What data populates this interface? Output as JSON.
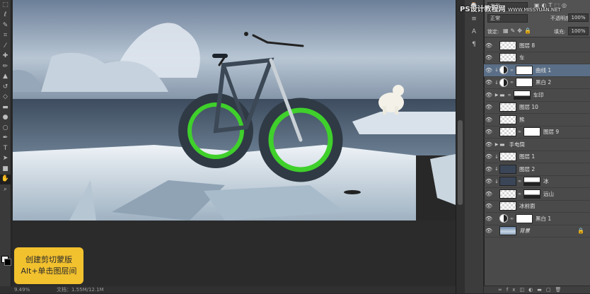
{
  "tools": [
    "marquee",
    "lasso",
    "quick-select",
    "crop",
    "eyedropper",
    "healing",
    "brush",
    "clone",
    "history",
    "eraser",
    "gradient",
    "blur",
    "dodge",
    "pen",
    "type",
    "path-select",
    "shape",
    "hand",
    "zoom"
  ],
  "status": {
    "zoom": "9.49%",
    "doc": "文档：1.55M/12.1M"
  },
  "callout": {
    "line1": "创建剪切蒙版",
    "line2": "Alt+单击图层间"
  },
  "watermark": {
    "line1": "PS设计教程网",
    "line2": "WWW.MISSYUAN.NET"
  },
  "layers_panel": {
    "kind": "类型",
    "blend_mode": "正常",
    "opacity_label": "不透明度:",
    "opacity_value": "100%",
    "lock_label": "锁定:",
    "fill_label": "填充:",
    "fill_value": "100%"
  },
  "layers": [
    {
      "name": "图层 8",
      "type": "pixel",
      "thumb": "checker",
      "selected": false
    },
    {
      "name": "车",
      "type": "pixel",
      "thumb": "checker",
      "selected": false
    },
    {
      "name": "曲线 1",
      "type": "adjustment",
      "thumb": "white",
      "selected": true,
      "clipped": true
    },
    {
      "name": "黑白 2",
      "type": "adjustment",
      "thumb": "white",
      "selected": false,
      "clipped": true
    },
    {
      "name": "车印",
      "type": "group",
      "thumb": "mask",
      "selected": false
    },
    {
      "name": "图层 10",
      "type": "pixel",
      "thumb": "checker",
      "selected": false
    },
    {
      "name": "熊",
      "type": "pixel",
      "thumb": "checker",
      "selected": false
    },
    {
      "name": "图层 9",
      "type": "pixel",
      "thumb": "checker",
      "selected": false
    },
    {
      "name": "手电筒",
      "type": "group",
      "selected": false
    },
    {
      "name": "图层 1",
      "type": "pixel",
      "thumb": "checker",
      "selected": false,
      "clipped": true
    },
    {
      "name": "图层 2",
      "type": "pixel",
      "thumb": "dark",
      "selected": false,
      "clipped": true
    },
    {
      "name": "冰",
      "type": "pixel",
      "thumb": "dark",
      "selected": false,
      "clipped": true,
      "masked": true
    },
    {
      "name": "远山",
      "type": "pixel",
      "thumb": "checker",
      "selected": false,
      "masked": true
    },
    {
      "name": "冰前面",
      "type": "pixel",
      "thumb": "checker",
      "selected": false
    },
    {
      "name": "黑白 1",
      "type": "adjustment",
      "thumb": "white",
      "selected": false
    },
    {
      "name": "背景",
      "type": "background",
      "thumb": "bg",
      "selected": false,
      "locked": true
    }
  ]
}
